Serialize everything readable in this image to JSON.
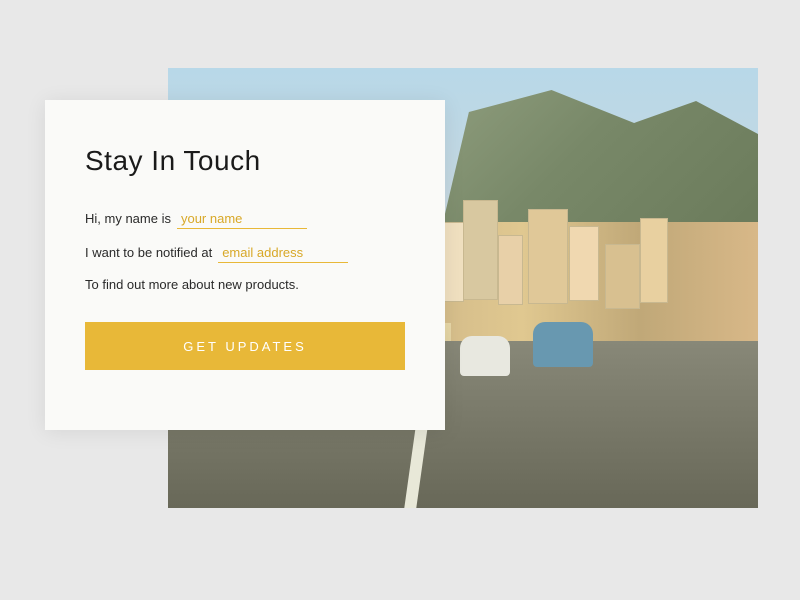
{
  "form": {
    "title": "Stay In Touch",
    "line1_prefix": "Hi, my name is",
    "name_placeholder": "your name",
    "line2_prefix": "I want to be notified at",
    "email_placeholder": "email address",
    "line3_text": "To find out more about new products.",
    "submit_label": "GET UPDATES"
  },
  "colors": {
    "accent": "#e8b838",
    "card_bg": "#fafaf8",
    "page_bg": "#e8e8e8"
  }
}
